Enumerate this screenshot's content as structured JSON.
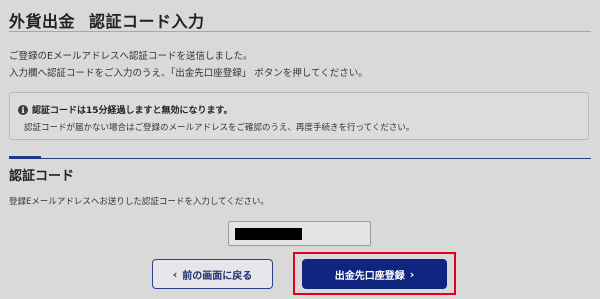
{
  "page": {
    "title_part1": "外貨出金",
    "title_part2": "認証コード入力"
  },
  "intro": {
    "line1": "ご登録のEメールアドレスへ認証コードを送信しました。",
    "line2": "入力欄へ認証コードをご入力のうえ、「出金先口座登録」 ボタンを押してください。"
  },
  "notice": {
    "icon": "info-icon",
    "icon_glyph": "i",
    "heading": "認証コードは15分経過しますと無効になります。",
    "body": "認証コードが届かない場合はご登録のメールアドレスをご確認のうえ、再度手続きを行ってください。"
  },
  "code_section": {
    "title": "認証コード",
    "description": "登録Eメールアドレスへお送りした認証コードを入力してください。",
    "input_value": ""
  },
  "buttons": {
    "back_label": "前の画面に戻る",
    "submit_label": "出金先口座登録",
    "back_icon": "chevron-left-icon",
    "submit_icon": "chevron-right-icon"
  },
  "colors": {
    "background": "#d9d9d9",
    "primary": "#0f2580",
    "highlight": "#e4001b"
  }
}
